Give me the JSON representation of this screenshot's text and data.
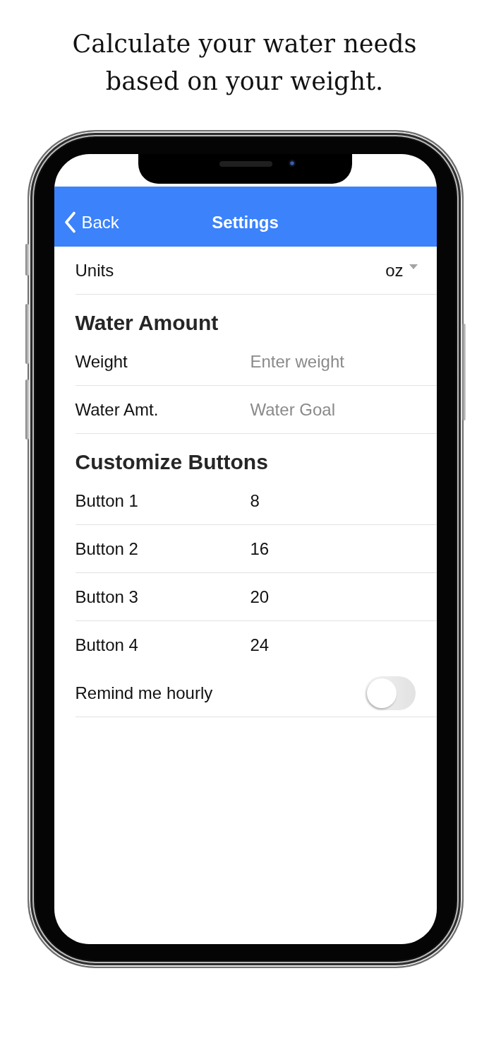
{
  "caption": "Calculate your water needs based on your weight.",
  "nav_bar": {
    "back": "Back",
    "title": "Settings"
  },
  "sections": [
    {
      "rows": [
        {
          "kind": "select",
          "label": "Units",
          "value": "oz",
          "divider": true
        }
      ]
    },
    {
      "title": "Water Amount",
      "rows": [
        {
          "kind": "field",
          "label": "Weight",
          "placeholder": "Enter weight",
          "divider": true
        },
        {
          "kind": "field",
          "label": "Water Amt.",
          "placeholder": "Water Goal",
          "divider": true
        }
      ]
    },
    {
      "title": "Customize Buttons",
      "rows": [
        {
          "kind": "field",
          "label": "Button 1",
          "value": "8",
          "divider": true
        },
        {
          "kind": "field",
          "label": "Button 2",
          "value": "16",
          "divider": true
        },
        {
          "kind": "field",
          "label": "Button 3",
          "value": "20",
          "divider": true
        },
        {
          "kind": "field",
          "label": "Button 4",
          "value": "24",
          "divider": false
        },
        {
          "kind": "switch",
          "label": "Remind me hourly",
          "on": false,
          "divider": true
        }
      ]
    }
  ]
}
